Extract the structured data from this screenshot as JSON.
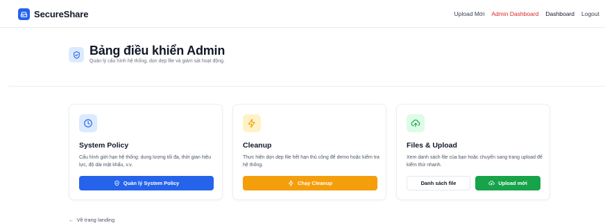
{
  "brand": {
    "name": "SecureShare"
  },
  "nav": {
    "links": [
      {
        "label": "Upload Mới"
      },
      {
        "label": "Admin Dashboard"
      },
      {
        "label": "Dashboard"
      },
      {
        "label": "Logout"
      }
    ],
    "active_color": "#dc2626"
  },
  "header": {
    "title": "Bảng điều khiển Admin",
    "subtitle": "Quản lý cấu hình hệ thống, dọn dẹp file và giám sát hoạt động."
  },
  "cards": [
    {
      "title": "System Policy",
      "description": "Cấu hình giới hạn hệ thống: dung lượng tối đa, thời gian hiệu lực, độ dài mật khẩu, v.v.",
      "icon": "clock-icon",
      "button_label": "Quản lý System Policy",
      "button_icon": "shield-icon",
      "accent": "#2563eb"
    },
    {
      "title": "Cleanup",
      "description": "Thực hiện dọn dẹp file hết hạn thủ công để demo hoặc kiểm tra hệ thống.",
      "icon": "lightning-icon",
      "button_label": "Chạy Cleanup",
      "button_icon": "lightning-icon",
      "accent": "#f59e0b"
    },
    {
      "title": "Files & Upload",
      "description": "Xem danh sách file của bạn hoặc chuyển sang trang upload để kiểm thử nhanh.",
      "icon": "cloud-upload-icon",
      "secondary_button_label": "Danh sách file",
      "button_label": "Upload mới",
      "button_icon": "cloud-upload-icon",
      "accent": "#16a34a"
    }
  ],
  "back_link": {
    "label": "Về trang landing",
    "icon": "arrow-left-icon"
  }
}
